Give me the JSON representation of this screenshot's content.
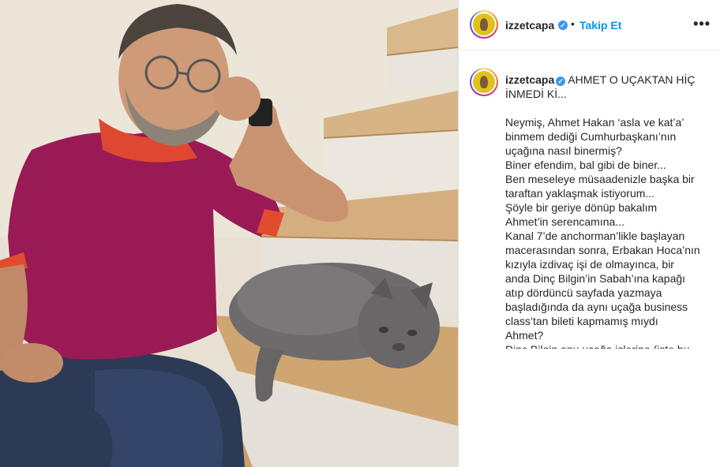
{
  "post": {
    "image_alt": "Man in a magenta polo shirt sitting on wooden stairs next to a grey cat",
    "header": {
      "username": "izzetcapa",
      "separator": "•",
      "follow_label": "Takip Et",
      "more_label": "•••"
    },
    "caption": {
      "username": "izzetcapa",
      "title": "AHMET O UÇAKTAN HİÇ İNMEDİ Kİ...",
      "lines": [
        "Neymiş, Ahmet Hakan ‘asla ve kat’a’",
        "binmem dediği Cumhurbaşkanı’nın",
        "uçağına nasıl binermiş?",
        "Biner efendim, bal gibi de biner...",
        "Ben meseleye müsaadenizle başka bir",
        "taraftan yaklaşmak istiyorum...",
        "Şöyle bir geriye dönüp bakalım",
        "Ahmet’in serencamına...",
        "Kanal 7’de anchorman’likle başlayan",
        "macerasından sonra, Erbakan Hoca’nın",
        "kızıyla izdivaç işi de olmayınca, bir",
        "anda Dinç Bilgin’in Sabah’ına kapağı",
        "atıp dördüncü sayfada yazmaya",
        "başladığında da aynı uçağa business",
        "class’tan bileti kapmamış mıydı",
        "Ahmet?",
        "Dinç Bilgin onu uçağa işlerine (işte bu da"
      ]
    }
  },
  "colors": {
    "link_blue": "#0095f6",
    "verified_blue": "#3897f0",
    "text": "#262626"
  },
  "icons": {
    "verified": "verified-badge-icon",
    "more": "more-options-icon"
  }
}
